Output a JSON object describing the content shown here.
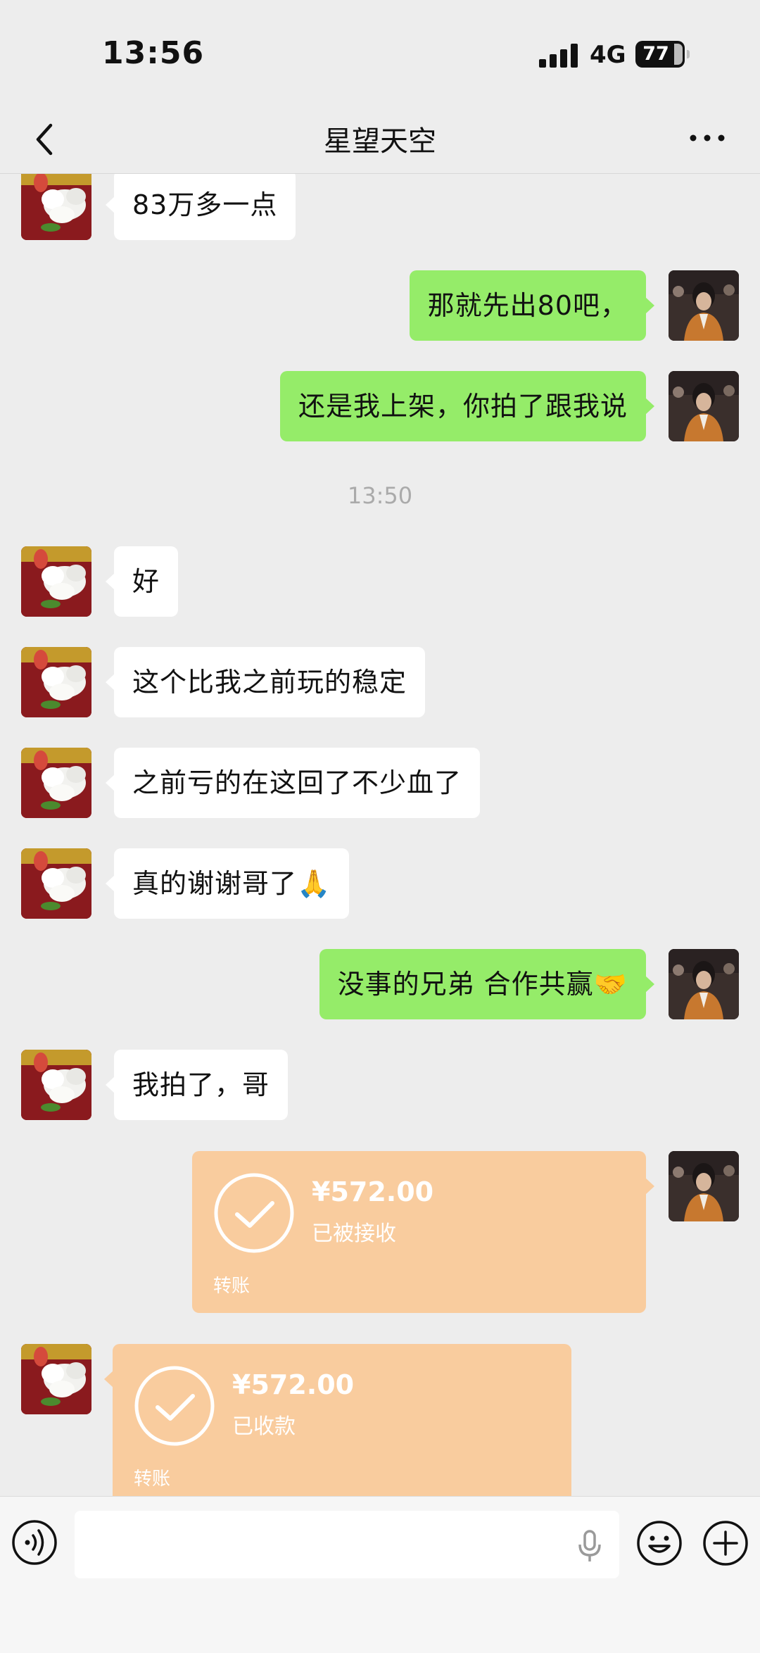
{
  "status_bar": {
    "time": "13:56",
    "network": "4G",
    "battery": "77"
  },
  "header": {
    "title": "星望天空",
    "back_icon": "chevron-left-icon",
    "more_icon": "more-dots-icon"
  },
  "messages": [
    {
      "from": "contact",
      "text": "83万多一点"
    },
    {
      "from": "me",
      "text": "那就先出80吧，"
    },
    {
      "from": "me",
      "text": "还是我上架，你拍了跟我说"
    },
    {
      "timestamp": "13:50"
    },
    {
      "from": "contact",
      "text": "好"
    },
    {
      "from": "contact",
      "text": "这个比我之前玩的稳定"
    },
    {
      "from": "contact",
      "text": "之前亏的在这回了不少血了"
    },
    {
      "from": "contact",
      "text": "真的谢谢哥了🙏"
    },
    {
      "from": "me",
      "text": "没事的兄弟 合作共赢🤝"
    },
    {
      "from": "contact",
      "text": "我拍了，哥"
    },
    {
      "from": "me",
      "type": "transfer",
      "amount": "¥572.00",
      "status": "已被接收",
      "label": "转账"
    },
    {
      "from": "contact",
      "type": "transfer",
      "amount": "¥572.00",
      "status": "已收款",
      "label": "转账"
    }
  ],
  "input_bar": {
    "voice_icon": "voice-icon",
    "mic_icon": "microphone-icon",
    "emoji_icon": "emoji-icon",
    "plus_icon": "plus-icon",
    "text_value": ""
  },
  "colors": {
    "background": "#ededed",
    "incoming_bubble": "#ffffff",
    "outgoing_bubble": "#95ec69",
    "transfer_card": "#f9cc9e",
    "timestamp_text": "#aaaaaa"
  }
}
